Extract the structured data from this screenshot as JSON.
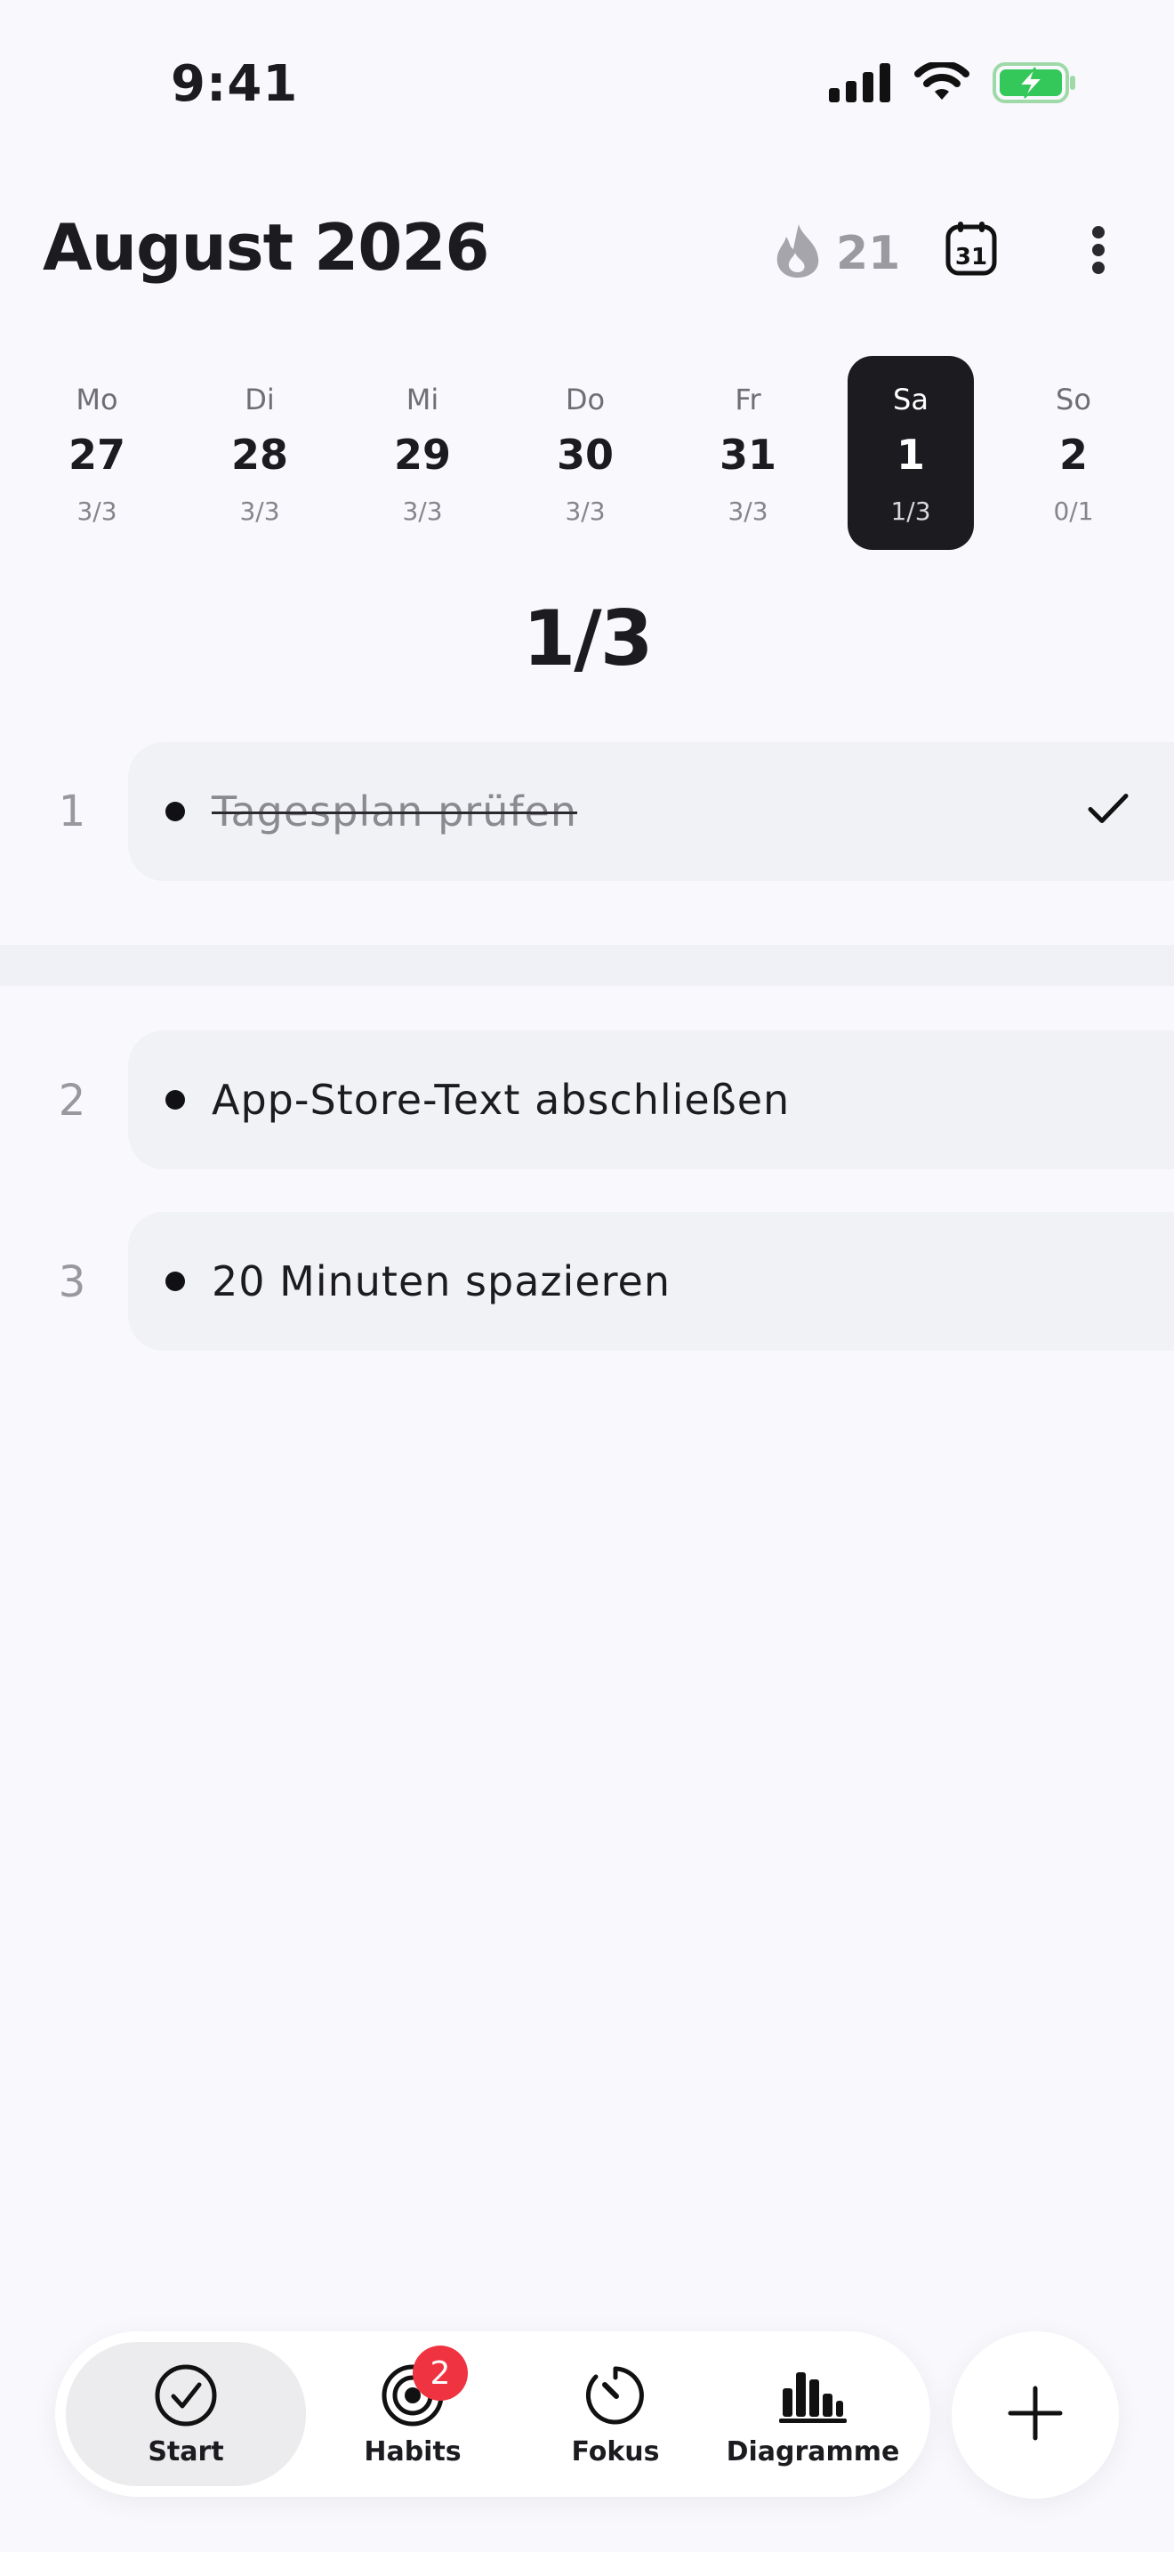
{
  "status_bar": {
    "time": "9:41",
    "icons": [
      "cellular-icon",
      "wifi-icon",
      "battery-charging-icon"
    ],
    "battery_color": "#34c759"
  },
  "header": {
    "title": "August 2026",
    "streak_count": "21",
    "icons": [
      "flame-icon",
      "calendar-31-icon",
      "more-vertical-icon"
    ]
  },
  "week": [
    {
      "dow": "Mo",
      "day": "27",
      "progress": "3/3",
      "selected": false
    },
    {
      "dow": "Di",
      "day": "28",
      "progress": "3/3",
      "selected": false
    },
    {
      "dow": "Mi",
      "day": "29",
      "progress": "3/3",
      "selected": false
    },
    {
      "dow": "Do",
      "day": "30",
      "progress": "3/3",
      "selected": false
    },
    {
      "dow": "Fr",
      "day": "31",
      "progress": "3/3",
      "selected": false
    },
    {
      "dow": "Sa",
      "day": "1",
      "progress": "1/3",
      "selected": true
    },
    {
      "dow": "So",
      "day": "2",
      "progress": "0/1",
      "selected": false
    }
  ],
  "summary": "1/3",
  "tasks": [
    {
      "index": "1",
      "text": "Tagesplan prüfen",
      "done": true
    },
    {
      "index": "2",
      "text": "App-Store-Text abschließen",
      "done": false
    },
    {
      "index": "3",
      "text": "20 Minuten spazieren",
      "done": false
    }
  ],
  "tabbar": {
    "tabs": [
      {
        "label": "Start",
        "icon": "checkmark-circle-icon",
        "active": true
      },
      {
        "label": "Habits",
        "icon": "target-icon",
        "active": false
      },
      {
        "label": "Fokus",
        "icon": "timer-icon",
        "active": false
      },
      {
        "label": "Diagramme",
        "icon": "bar-chart-icon",
        "active": false
      }
    ],
    "habits_badge": "2",
    "badge_color": "#ef3340"
  },
  "add_button": {
    "icon": "plus-icon"
  }
}
